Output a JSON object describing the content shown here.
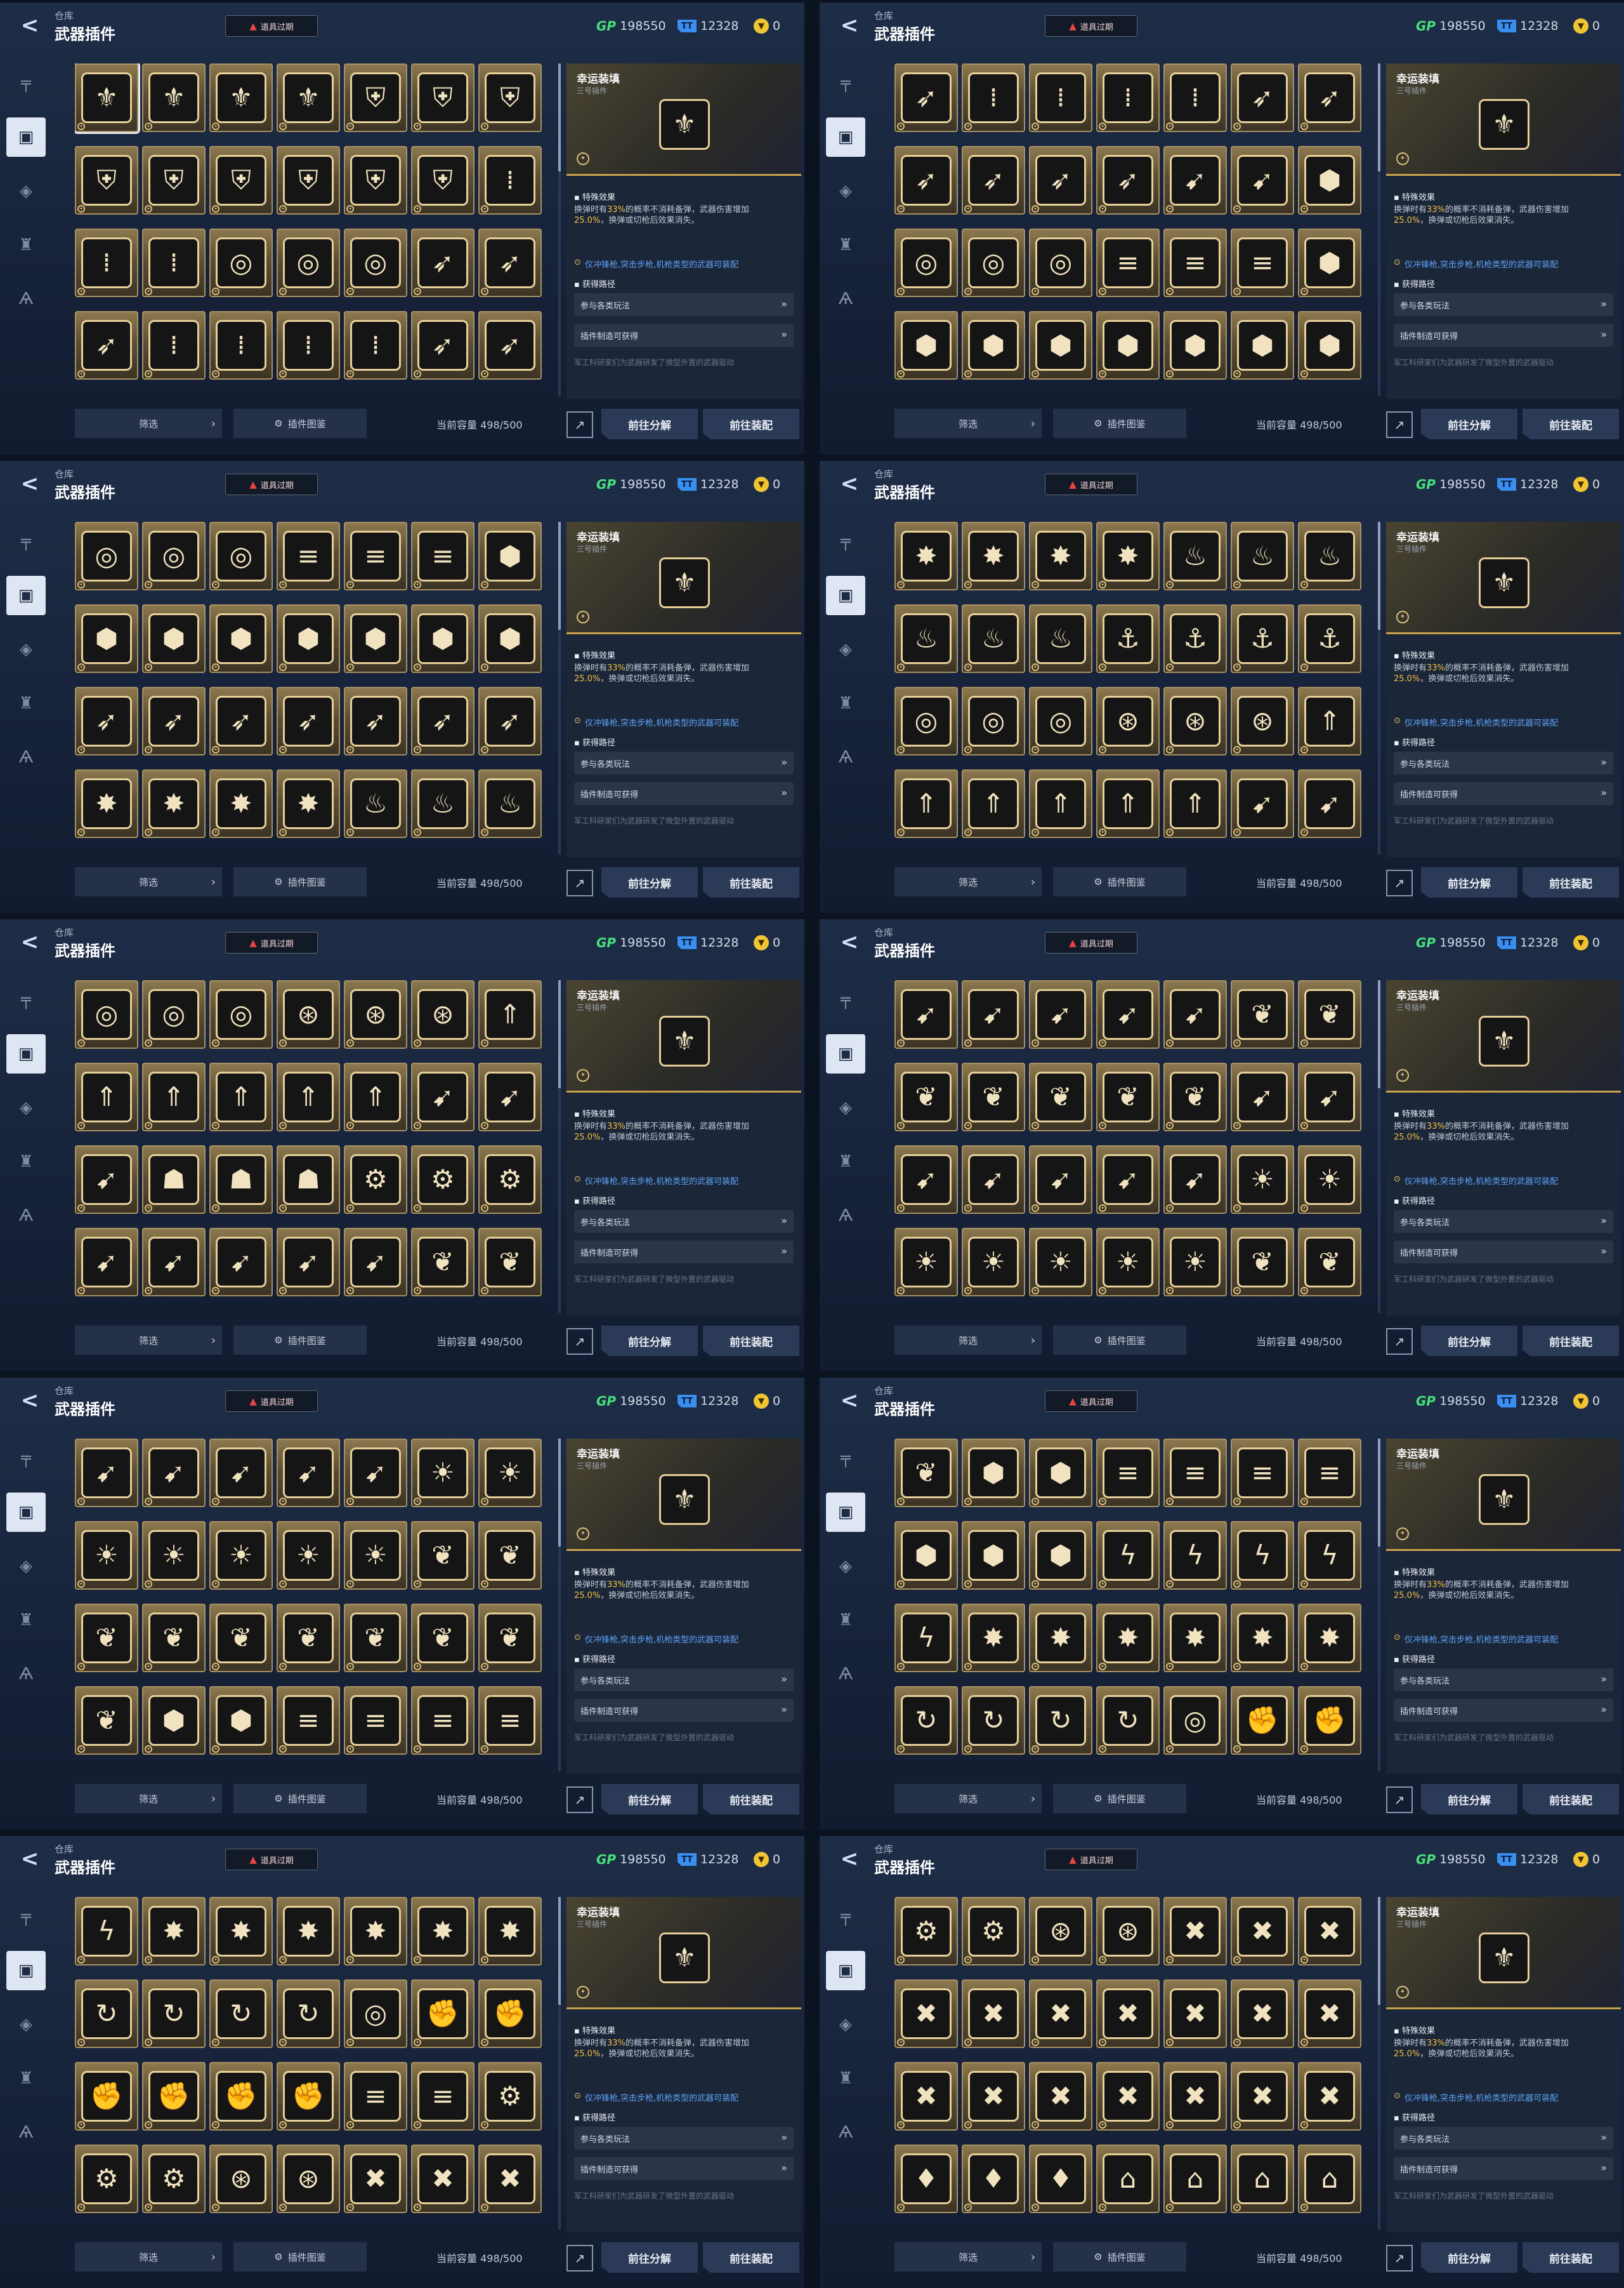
{
  "ui": {
    "breadcrumb": "仓库",
    "title": "武器插件",
    "expired_label": "道具过期",
    "gp_label": "GP",
    "gp_value": "198550",
    "ticket_value": "12328",
    "token_value": "0",
    "detail": {
      "name": "幸运装填",
      "subtitle": "三号插件",
      "effect_title": "特殊效果",
      "effect_pre": "换弹时有",
      "effect_pct": "33%",
      "effect_mid": "的概率不消耗备弹，武器伤害增加",
      "effect_val": "25.0%",
      "effect_post": "，换弹或切枪后效果消失。",
      "weapon_note": "仅冲锋枪,突击步枪,机枪类型的武器可装配",
      "source_title": "获得路径",
      "source_1": "参与各类玩法",
      "source_2": "插件制造可获得",
      "flavor": "军工科研家们为武器研发了微型外置的武器驱动"
    },
    "footer": {
      "filter": "筛选",
      "codex": "插件图鉴",
      "capacity": "当前容量 498/500",
      "dismantle": "前往分解",
      "equip": "前往装配"
    }
  },
  "icons": {
    "wing": "wing-emblem-icon",
    "shield": "shield-emblem-icon",
    "bullets": "bullet-stack-icon",
    "target": "target-icon",
    "rocket": "rocket-icon",
    "hex": "hexagon-emblem-icon",
    "burst": "burst-icon",
    "flame": "flame-icon",
    "anchor": "anchor-icon",
    "orbit": "orbit-icon",
    "arrow": "arrow-up-icon",
    "spear": "spear-icon",
    "helm": "helmet-icon",
    "gear": "gear-icon",
    "sun": "sun-icon",
    "leaf": "leaf-icon",
    "bars": "bars-icon",
    "bolt": "bolt-icon",
    "loop": "loop-icon",
    "fist": "fist-icon",
    "cross": "cross-icon",
    "bell": "bell-icon",
    "house": "house-icon"
  },
  "panels": [
    {
      "rows": [
        [
          "wing",
          "wing",
          "wing",
          "wing",
          "shield",
          "shield",
          "shield"
        ],
        [
          "shield",
          "shield",
          "shield",
          "shield",
          "shield",
          "shield",
          "bullets"
        ],
        [
          "bullets",
          "bullets",
          "target",
          "target",
          "target",
          "rocket",
          "rocket"
        ],
        [
          "rocket",
          "bullets",
          "bullets",
          "bullets",
          "bullets",
          "rocket",
          "rocket"
        ]
      ]
    },
    {
      "rows": [
        [
          "rocket",
          "bullets",
          "bullets",
          "bullets",
          "bullets",
          "rocket",
          "rocket"
        ],
        [
          "rocket",
          "rocket",
          "rocket",
          "rocket",
          "spear",
          "spear",
          "hex"
        ],
        [
          "target",
          "target",
          "target",
          "bars",
          "bars",
          "bars",
          "hex"
        ],
        [
          "hex",
          "hex",
          "hex",
          "hex",
          "hex",
          "hex",
          "hex"
        ]
      ]
    },
    {
      "rows": [
        [
          "target",
          "target",
          "target",
          "bars",
          "bars",
          "bars",
          "hex"
        ],
        [
          "hex",
          "hex",
          "hex",
          "hex",
          "hex",
          "hex",
          "hex"
        ],
        [
          "rocket",
          "rocket",
          "rocket",
          "rocket",
          "rocket",
          "rocket",
          "rocket"
        ],
        [
          "burst",
          "burst",
          "burst",
          "burst",
          "flame",
          "flame",
          "flame"
        ]
      ]
    },
    {
      "rows": [
        [
          "burst",
          "burst",
          "burst",
          "burst",
          "flame",
          "flame",
          "flame"
        ],
        [
          "flame",
          "flame",
          "flame",
          "anchor",
          "anchor",
          "anchor",
          "anchor"
        ],
        [
          "target",
          "target",
          "target",
          "orbit",
          "orbit",
          "orbit",
          "arrow"
        ],
        [
          "arrow",
          "arrow",
          "arrow",
          "arrow",
          "arrow",
          "spear",
          "spear"
        ]
      ]
    },
    {
      "rows": [
        [
          "target",
          "target",
          "target",
          "orbit",
          "orbit",
          "orbit",
          "arrow"
        ],
        [
          "arrow",
          "arrow",
          "arrow",
          "arrow",
          "arrow",
          "spear",
          "spear"
        ],
        [
          "spear",
          "helm",
          "helm",
          "helm",
          "gear",
          "gear",
          "gear"
        ],
        [
          "spear",
          "spear",
          "spear",
          "spear",
          "spear",
          "leaf",
          "leaf"
        ]
      ]
    },
    {
      "rows": [
        [
          "spear",
          "spear",
          "spear",
          "spear",
          "spear",
          "leaf",
          "leaf"
        ],
        [
          "leaf",
          "leaf",
          "leaf",
          "leaf",
          "leaf",
          "spear",
          "spear"
        ],
        [
          "spear",
          "spear",
          "spear",
          "spear",
          "spear",
          "sun",
          "sun"
        ],
        [
          "sun",
          "sun",
          "sun",
          "sun",
          "sun",
          "leaf",
          "leaf"
        ]
      ]
    },
    {
      "rows": [
        [
          "spear",
          "spear",
          "spear",
          "spear",
          "spear",
          "sun",
          "sun"
        ],
        [
          "sun",
          "sun",
          "sun",
          "sun",
          "sun",
          "leaf",
          "leaf"
        ],
        [
          "leaf",
          "leaf",
          "leaf",
          "leaf",
          "leaf",
          "leaf",
          "leaf"
        ],
        [
          "leaf",
          "hex",
          "hex",
          "bars",
          "bars",
          "bars",
          "bars"
        ]
      ]
    },
    {
      "rows": [
        [
          "leaf",
          "hex",
          "hex",
          "bars",
          "bars",
          "bars",
          "bars"
        ],
        [
          "hex",
          "hex",
          "hex",
          "bolt",
          "bolt",
          "bolt",
          "bolt"
        ],
        [
          "bolt",
          "burst",
          "burst",
          "burst",
          "burst",
          "burst",
          "burst"
        ],
        [
          "loop",
          "loop",
          "loop",
          "loop",
          "target",
          "fist",
          "fist"
        ]
      ]
    },
    {
      "rows": [
        [
          "bolt",
          "burst",
          "burst",
          "burst",
          "burst",
          "burst",
          "burst"
        ],
        [
          "loop",
          "loop",
          "loop",
          "loop",
          "target",
          "fist",
          "fist"
        ],
        [
          "fist",
          "fist",
          "fist",
          "fist",
          "bars",
          "bars",
          "gear"
        ],
        [
          "gear",
          "gear",
          "orbit",
          "orbit",
          "cross",
          "cross",
          "cross"
        ]
      ]
    },
    {
      "rows": [
        [
          "gear",
          "gear",
          "orbit",
          "orbit",
          "cross",
          "cross",
          "cross"
        ],
        [
          "cross",
          "cross",
          "cross",
          "cross",
          "cross",
          "cross",
          "cross"
        ],
        [
          "cross",
          "cross",
          "cross",
          "cross",
          "cross",
          "cross",
          "cross"
        ],
        [
          "bell",
          "bell",
          "bell",
          "house",
          "house",
          "house",
          "house"
        ]
      ]
    }
  ]
}
